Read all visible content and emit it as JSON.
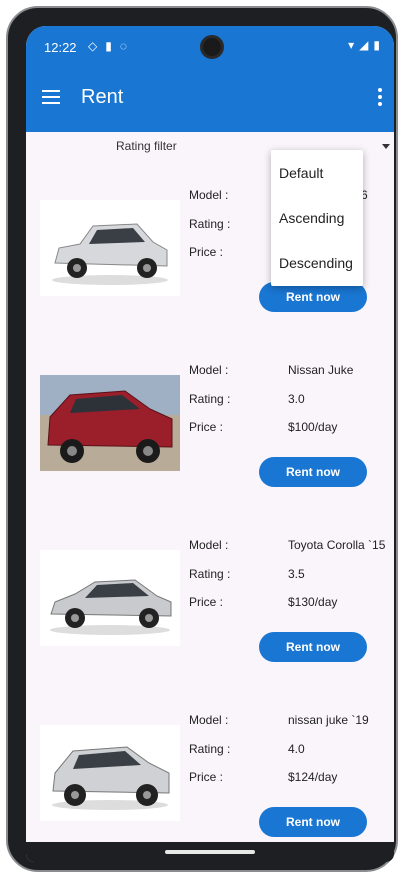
{
  "status": {
    "time": "12:22"
  },
  "appbar": {
    "title": "Rent"
  },
  "filter": {
    "label": "Rating filter"
  },
  "dropdown": {
    "options": [
      "Default",
      "Ascending",
      "Descending"
    ]
  },
  "labels": {
    "model": "Model :",
    "rating": "Rating :",
    "price": "Price :",
    "rent_button": "Rent now"
  },
  "cars": [
    {
      "model": "6",
      "rating": "",
      "price": "",
      "image": "white-compact-car"
    },
    {
      "model": "Nissan Juke",
      "rating": "3.0",
      "price": "$100/day",
      "image": "red-suv"
    },
    {
      "model": "Toyota Corolla `15",
      "rating": "3.5",
      "price": "$130/day",
      "image": "silver-sedan"
    },
    {
      "model": "nissan juke `19",
      "rating": "4.0",
      "price": "$124/day",
      "image": "silver-suv"
    }
  ],
  "colors": {
    "primary": "#1976d2",
    "background": "#faf5fb"
  }
}
